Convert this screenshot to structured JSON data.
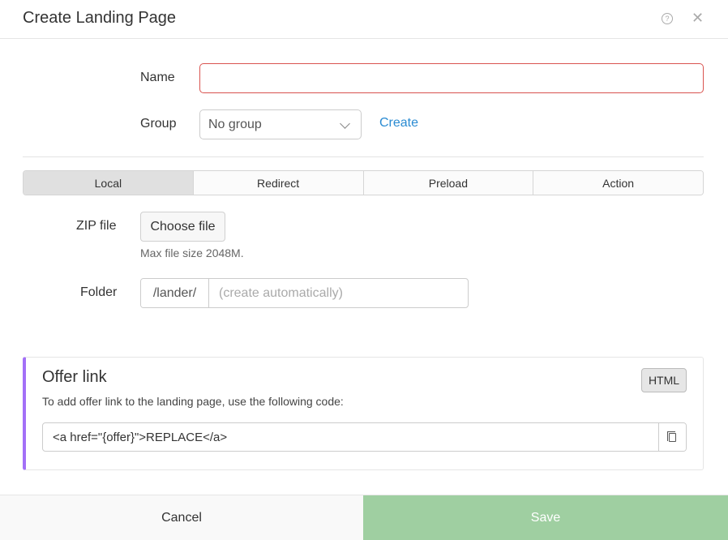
{
  "header": {
    "title": "Create Landing Page",
    "help_icon": "question-circle-icon",
    "close_icon": "close-icon",
    "close_glyph": "✕",
    "help_glyph": "?"
  },
  "form": {
    "name": {
      "label": "Name",
      "value": "",
      "placeholder": ""
    },
    "group": {
      "label": "Group",
      "selected": "No group"
    },
    "create_link": "Create"
  },
  "tabs": [
    {
      "label": "Local",
      "active": true
    },
    {
      "label": "Redirect",
      "active": false
    },
    {
      "label": "Preload",
      "active": false
    },
    {
      "label": "Action",
      "active": false
    }
  ],
  "zip": {
    "label": "ZIP file",
    "button": "Choose file",
    "hint": "Max file size 2048M."
  },
  "folder": {
    "label": "Folder",
    "prefix": "/lander/",
    "placeholder": "(create automatically)"
  },
  "offer": {
    "title": "Offer link",
    "description": "To add offer link to the landing page, use the following code:",
    "html_button": "HTML",
    "code": "<a href=\"{offer}\">REPLACE</a>",
    "copy_icon": "copy-icon"
  },
  "footer": {
    "cancel": "Cancel",
    "save": "Save"
  },
  "colors": {
    "accent_link": "#2a8bd2",
    "error_border": "#d9534f",
    "offer_accent": "#a370f7",
    "save_bg": "#9fcfa1"
  }
}
